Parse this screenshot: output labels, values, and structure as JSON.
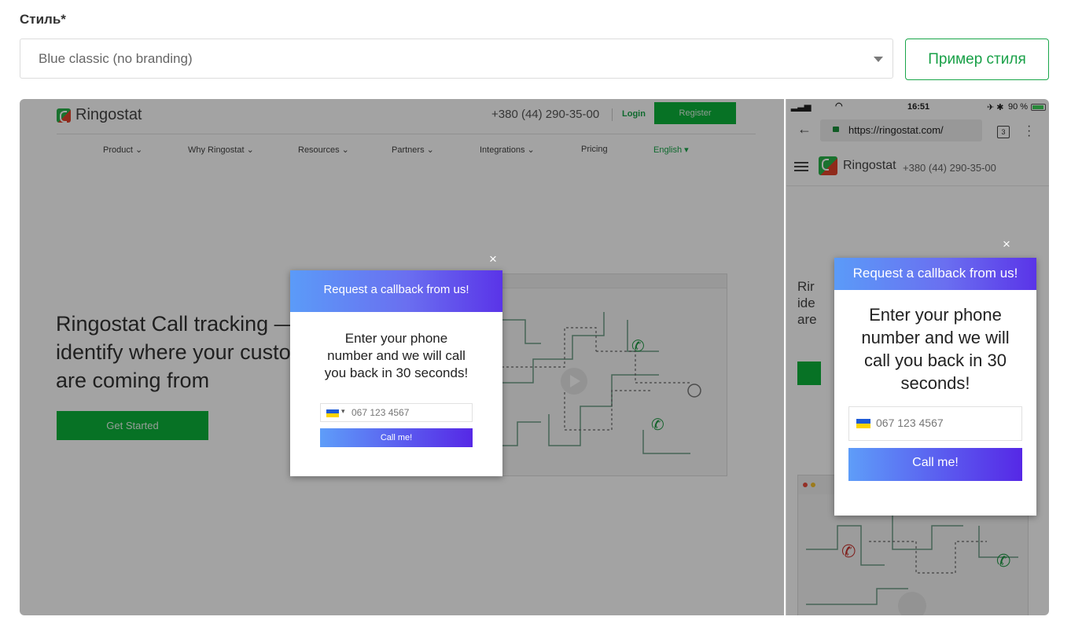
{
  "form": {
    "style_label": "Стиль*",
    "style_value": "Blue classic (no branding)",
    "example_button": "Пример стиля"
  },
  "desktop": {
    "logo": "Ringostat",
    "phone": "+380 (44) 290-35-00",
    "login": "Login",
    "register": "Register",
    "nav": [
      "Product",
      "Why Ringostat",
      "Resources",
      "Partners",
      "Integrations",
      "Pricing",
      "English"
    ],
    "hero_lines": [
      "Ringostat Call tracking —",
      "identify where your custo",
      "are coming from"
    ],
    "get_started": "Get Started"
  },
  "popup": {
    "close": "×",
    "header": "Request a callback from us!",
    "text_desktop": [
      "Enter your phone",
      "number and we will call",
      "you back in 30 seconds!"
    ],
    "text_mobile": [
      "Enter your phone",
      "number and we will",
      "call you back in 30",
      "seconds!"
    ],
    "phone_placeholder": "067 123 4567",
    "call_button": "Call me!"
  },
  "mobile": {
    "status_time": "16:51",
    "status_battery": "90 %",
    "url": "https://ringostat.com/",
    "tabs_count": "3",
    "logo": "Ringostat",
    "phone": "+380 (44) 290-35-00",
    "hero_lines": [
      "Rir",
      "ide",
      "are"
    ]
  },
  "colors": {
    "accent_green": "#18a047",
    "popup_gradient_start": "#5b9bf8",
    "popup_gradient_end": "#5a34e8"
  }
}
